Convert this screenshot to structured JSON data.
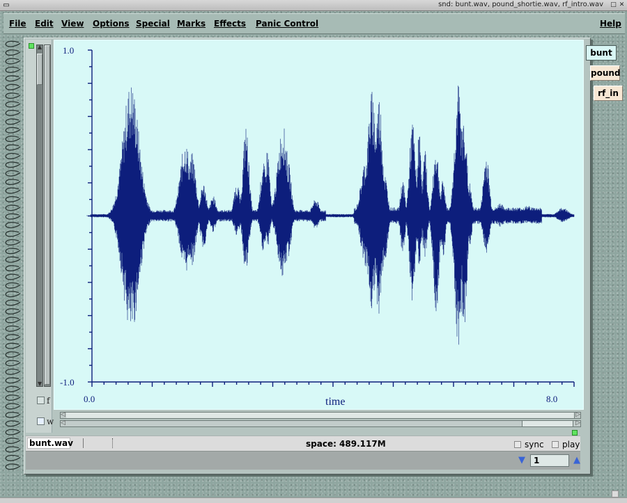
{
  "window": {
    "title": "snd: bunt.wav, pound_shortie.wav, rf_intro.wav",
    "sysmenu_icon": "window-menu-icon",
    "buttons": [
      "minimize-icon",
      "close-icon"
    ]
  },
  "menubar": {
    "items": [
      "File",
      "Edit",
      "View",
      "Options",
      "Special",
      "Marks",
      "Effects",
      "Panic Control"
    ],
    "help": "Help"
  },
  "graph": {
    "y_top_label": "1.0",
    "y_bottom_label": "-1.0",
    "x_start_label": "0.0",
    "x_end_label": "8.0",
    "x_axis_title": "time",
    "waveform_color": "#0d1e7c",
    "background_color": "#d8f9f7"
  },
  "left_controls": {
    "f_label": "f",
    "w_label": "w"
  },
  "status": {
    "filename": "bunt.wav",
    "space_text": "space: 489.117M",
    "sync_label": "sync",
    "play_label": "play"
  },
  "spinner": {
    "value": "1"
  },
  "sound_tabs": [
    {
      "label": "bunt",
      "active": true
    },
    {
      "label": "pound",
      "active": false
    },
    {
      "label": "rf_in",
      "active": false
    }
  ]
}
